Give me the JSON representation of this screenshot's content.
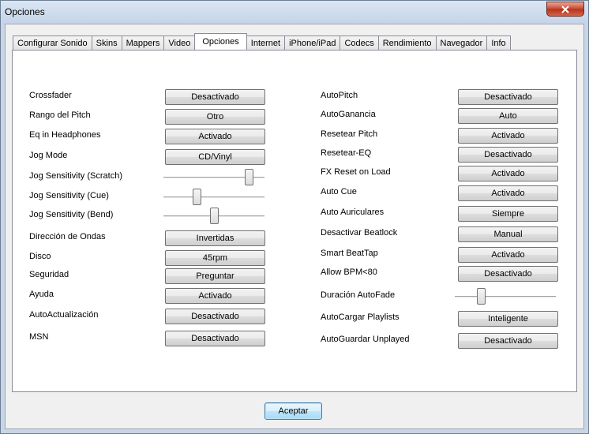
{
  "window": {
    "title": "Opciones"
  },
  "tabs": [
    "Configurar Sonido",
    "Skins",
    "Mappers",
    "Video",
    "Opciones",
    "Internet",
    "iPhone/iPad",
    "Codecs",
    "Rendimiento",
    "Navegador",
    "Info"
  ],
  "active_tab": "Opciones",
  "left_column": [
    {
      "label": "Crossfader",
      "type": "button",
      "value": "Desactivado"
    },
    {
      "label": "Rango del Pitch",
      "type": "button",
      "value": "Otro"
    },
    {
      "label": "Eq in Headphones",
      "type": "button",
      "value": "Activado"
    },
    {
      "label": "Jog Mode",
      "type": "button",
      "value": "CD/Vinyl"
    },
    {
      "label": "Jog Sensitivity (Scratch)",
      "type": "slider",
      "level": 0.84
    },
    {
      "label": "Jog Sensitivity (Cue)",
      "type": "slider",
      "level": 0.33
    },
    {
      "label": "Jog Sensitivity (Bend)",
      "type": "slider",
      "level": 0.5
    },
    {
      "label": "Dirección de Ondas",
      "type": "button",
      "value": "Invertidas"
    },
    {
      "label": "Disco",
      "type": "button",
      "value": "45rpm"
    },
    {
      "label": "Seguridad",
      "type": "button",
      "value": "Preguntar"
    },
    {
      "label": "Ayuda",
      "type": "button",
      "value": "Activado"
    },
    {
      "label": "AutoActualización",
      "type": "button",
      "value": "Desactivado"
    },
    {
      "label": "MSN",
      "type": "button",
      "value": "Desactivado"
    }
  ],
  "right_column": [
    {
      "label": "AutoPitch",
      "type": "button",
      "value": "Desactivado"
    },
    {
      "label": "AutoGanancia",
      "type": "button",
      "value": "Auto"
    },
    {
      "label": "Resetear Pitch",
      "type": "button",
      "value": "Activado"
    },
    {
      "label": "Resetear-EQ",
      "type": "button",
      "value": "Desactivado"
    },
    {
      "label": "FX Reset on Load",
      "type": "button",
      "value": "Activado"
    },
    {
      "label": "Auto Cue",
      "type": "button",
      "value": "Activado"
    },
    {
      "label": "Auto Auriculares",
      "type": "button",
      "value": "Siempre"
    },
    {
      "label": "Desactivar Beatlock",
      "type": "button",
      "value": "Manual"
    },
    {
      "label": "Smart BeatTap",
      "type": "button",
      "value": "Activado"
    },
    {
      "label": "Allow BPM<80",
      "type": "button",
      "value": "Desactivado"
    },
    {
      "label": "Duración AutoFade",
      "type": "slider",
      "level": 0.26
    },
    {
      "label": "AutoCargar Playlists",
      "type": "button",
      "value": "Inteligente"
    },
    {
      "label": "AutoGuardar Unplayed",
      "type": "button",
      "value": "Desactivado"
    }
  ],
  "footer": {
    "accept_label": "Aceptar"
  }
}
